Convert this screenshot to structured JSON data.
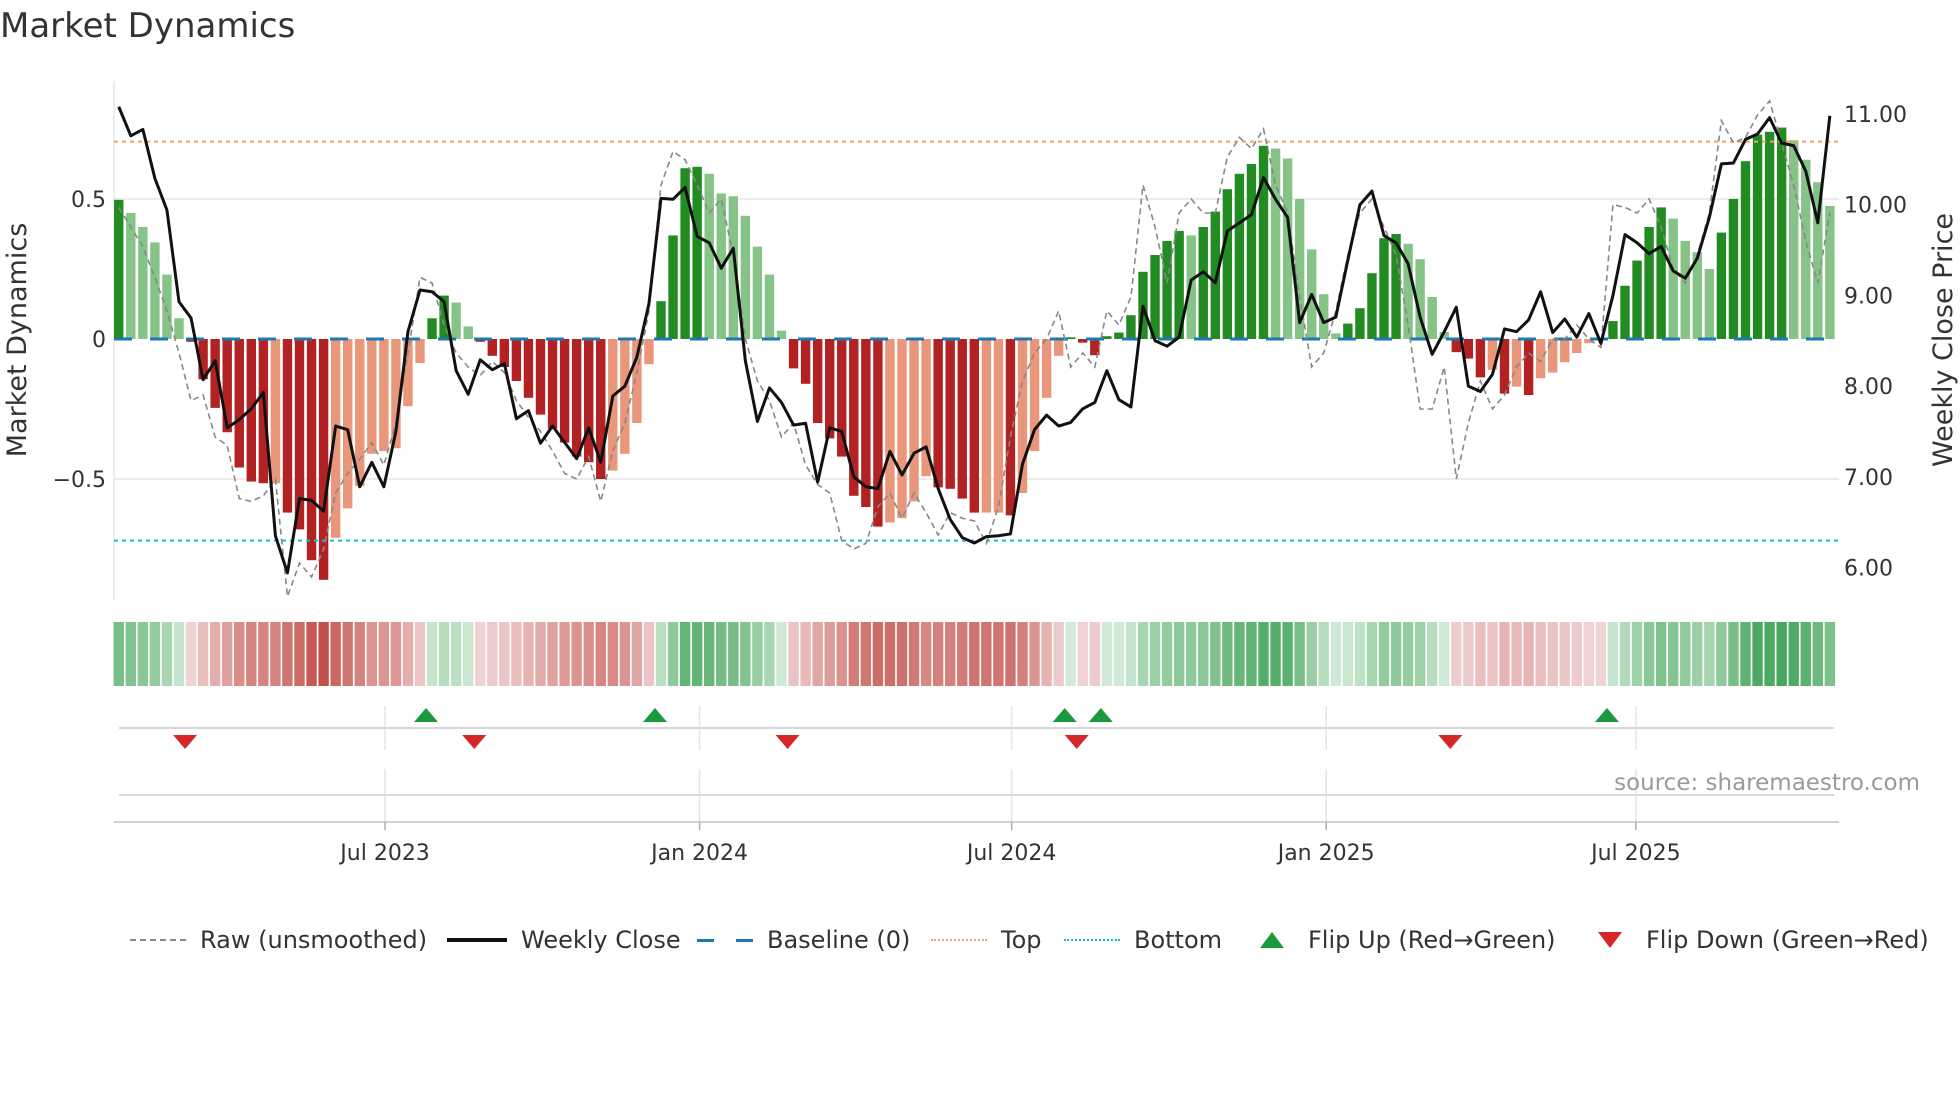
{
  "title": "Market Dynamics",
  "source": "source: sharemaestro.com",
  "colors": {
    "up_strong": "#228b22",
    "up_weak": "#86c386",
    "down_strong": "#b22222",
    "down_weak": "#e9967a",
    "baseline": "#1f77b4",
    "top": "#f0a35e",
    "bottom": "#17becf",
    "raw": "#888888",
    "close": "#111111",
    "flip_up": "#1a9a3c",
    "flip_down": "#d62728"
  },
  "legend": [
    {
      "label": "Raw (unsmoothed)"
    },
    {
      "label": "Weekly Close"
    },
    {
      "label": "Baseline (0)"
    },
    {
      "label": "Top"
    },
    {
      "label": "Bottom"
    },
    {
      "label": "Flip Up (Red→Green)"
    },
    {
      "label": "Flip Down (Green→Red)"
    }
  ],
  "chart_data": {
    "type": "bar",
    "title": "Market Dynamics",
    "ylabel": "Market Dynamics",
    "y2label": "Weekly Close Price",
    "ylim": [
      -0.93,
      0.92
    ],
    "y2lim": [
      5.6,
      11.3
    ],
    "yticks": [
      {
        "v": 0.5,
        "label": "0.5"
      },
      {
        "v": 0,
        "label": "0"
      },
      {
        "v": -0.5,
        "label": "−0.5"
      }
    ],
    "y2ticks": [
      {
        "v": 11,
        "label": "11.00"
      },
      {
        "v": 10,
        "label": "10.00"
      },
      {
        "v": 9,
        "label": "9.00"
      },
      {
        "v": 8,
        "label": "8.00"
      },
      {
        "v": 7,
        "label": "7.00"
      },
      {
        "v": 6,
        "label": "6.00"
      }
    ],
    "xticks": [
      {
        "week": 22.1,
        "label": "Jul 2023"
      },
      {
        "week": 48.2,
        "label": "Jan 2024"
      },
      {
        "week": 74.1,
        "label": "Jul 2024"
      },
      {
        "week": 100.2,
        "label": "Jan 2025"
      },
      {
        "week": 125.9,
        "label": "Jul 2025"
      }
    ],
    "top_level": 0.705,
    "bottom_level": -0.72,
    "baseline": 0,
    "dynamics": [
      0.497,
      0.45,
      0.4,
      0.345,
      0.23,
      0.074,
      -0.01,
      -0.144,
      -0.246,
      -0.333,
      -0.459,
      -0.509,
      -0.515,
      -0.515,
      -0.62,
      -0.68,
      -0.79,
      -0.86,
      -0.71,
      -0.605,
      -0.525,
      -0.41,
      -0.4,
      -0.39,
      -0.24,
      -0.086,
      0.074,
      0.155,
      0.13,
      0.045,
      -0.01,
      -0.06,
      -0.1,
      -0.15,
      -0.21,
      -0.27,
      -0.32,
      -0.37,
      -0.42,
      -0.44,
      -0.5,
      -0.47,
      -0.41,
      -0.3,
      -0.09,
      0.135,
      0.37,
      0.61,
      0.615,
      0.59,
      0.52,
      0.51,
      0.44,
      0.33,
      0.23,
      0.03,
      -0.105,
      -0.16,
      -0.3,
      -0.355,
      -0.42,
      -0.56,
      -0.6,
      -0.67,
      -0.655,
      -0.64,
      -0.58,
      -0.49,
      -0.53,
      -0.535,
      -0.57,
      -0.62,
      -0.62,
      -0.62,
      -0.63,
      -0.55,
      -0.4,
      -0.21,
      -0.06,
      0.006,
      -0.013,
      -0.058,
      0.01,
      0.023,
      0.085,
      0.24,
      0.3,
      0.35,
      0.386,
      0.37,
      0.4,
      0.455,
      0.535,
      0.59,
      0.625,
      0.69,
      0.68,
      0.645,
      0.5,
      0.32,
      0.16,
      0.02,
      0.055,
      0.11,
      0.235,
      0.36,
      0.375,
      0.34,
      0.285,
      0.15,
      0.025,
      -0.047,
      -0.07,
      -0.137,
      -0.11,
      -0.195,
      -0.17,
      -0.2,
      -0.14,
      -0.12,
      -0.083,
      -0.05,
      -0.015,
      -0.005,
      0.064,
      0.19,
      0.28,
      0.4,
      0.47,
      0.43,
      0.35,
      0.31,
      0.25,
      0.38,
      0.5,
      0.635,
      0.73,
      0.74,
      0.755,
      0.71,
      0.64,
      0.56,
      0.475
    ],
    "raw": [
      0.47,
      0.4,
      0.33,
      0.22,
      0.1,
      -0.05,
      -0.22,
      -0.2,
      -0.35,
      -0.38,
      -0.57,
      -0.58,
      -0.56,
      -0.5,
      -0.92,
      -0.8,
      -0.85,
      -0.75,
      -0.55,
      -0.48,
      -0.43,
      -0.37,
      -0.45,
      -0.3,
      -0.05,
      0.22,
      0.2,
      0.05,
      -0.05,
      -0.1,
      -0.13,
      -0.08,
      -0.12,
      -0.22,
      -0.28,
      -0.33,
      -0.4,
      -0.48,
      -0.5,
      -0.42,
      -0.58,
      -0.4,
      -0.3,
      -0.12,
      0.1,
      0.55,
      0.67,
      0.64,
      0.55,
      0.45,
      0.5,
      0.3,
      0.0,
      -0.15,
      -0.22,
      -0.35,
      -0.3,
      -0.45,
      -0.52,
      -0.55,
      -0.72,
      -0.75,
      -0.73,
      -0.6,
      -0.55,
      -0.64,
      -0.55,
      -0.62,
      -0.7,
      -0.62,
      -0.64,
      -0.65,
      -0.73,
      -0.6,
      -0.35,
      -0.15,
      -0.05,
      0.0,
      0.1,
      -0.1,
      -0.05,
      -0.1,
      0.1,
      0.05,
      0.15,
      0.55,
      0.4,
      0.2,
      0.45,
      0.5,
      0.45,
      0.45,
      0.65,
      0.72,
      0.68,
      0.75,
      0.55,
      0.45,
      0.15,
      -0.1,
      -0.05,
      0.1,
      0.3,
      0.45,
      0.5,
      0.4,
      0.3,
      0.05,
      -0.25,
      -0.25,
      -0.1,
      -0.5,
      -0.3,
      -0.15,
      -0.25,
      -0.2,
      -0.1,
      -0.05,
      -0.08,
      0.0,
      0.0,
      0.05,
      0.0,
      -0.03,
      0.48,
      0.47,
      0.45,
      0.5,
      0.4,
      0.25,
      0.2,
      0.3,
      0.45,
      0.78,
      0.7,
      0.72,
      0.8,
      0.85,
      0.7,
      0.55,
      0.35,
      0.2,
      0.45
    ],
    "weekly_close": [
      11.08,
      10.76,
      10.83,
      10.29,
      9.94,
      8.93,
      8.75,
      8.07,
      8.28,
      7.54,
      7.63,
      7.75,
      7.93,
      6.35,
      5.94,
      6.76,
      6.74,
      6.62,
      7.56,
      7.52,
      6.89,
      7.16,
      6.89,
      7.5,
      8.6,
      9.06,
      9.04,
      8.93,
      8.17,
      7.91,
      8.29,
      8.18,
      8.25,
      7.64,
      7.73,
      7.37,
      7.56,
      7.38,
      7.2,
      7.54,
      7.16,
      7.89,
      8.0,
      8.32,
      8.91,
      10.07,
      10.06,
      10.19,
      9.65,
      9.58,
      9.3,
      9.52,
      8.28,
      7.61,
      7.98,
      7.82,
      7.57,
      7.59,
      6.94,
      7.54,
      7.5,
      7.0,
      6.89,
      6.87,
      7.28,
      7.02,
      7.26,
      7.33,
      6.87,
      6.53,
      6.33,
      6.27,
      6.34,
      6.35,
      6.37,
      7.14,
      7.52,
      7.68,
      7.56,
      7.6,
      7.75,
      7.82,
      8.17,
      7.85,
      7.77,
      8.88,
      8.5,
      8.44,
      8.54,
      9.17,
      9.26,
      9.14,
      9.71,
      9.8,
      9.89,
      10.3,
      10.06,
      9.86,
      8.7,
      9.01,
      8.7,
      8.76,
      9.39,
      10.0,
      10.15,
      9.66,
      9.58,
      9.35,
      8.76,
      8.35,
      8.6,
      8.87,
      8.0,
      7.94,
      8.13,
      8.63,
      8.6,
      8.73,
      9.04,
      8.59,
      8.74,
      8.54,
      8.8,
      8.47,
      9.0,
      9.67,
      9.58,
      9.46,
      9.54,
      9.27,
      9.19,
      9.41,
      9.86,
      10.45,
      10.46,
      10.72,
      10.78,
      10.96,
      10.68,
      10.65,
      10.37,
      9.8,
      10.98
    ]
  }
}
